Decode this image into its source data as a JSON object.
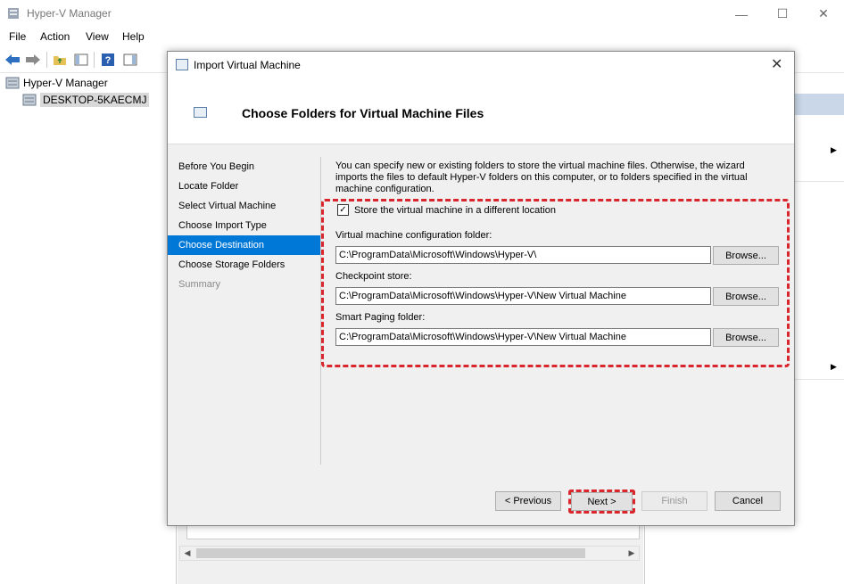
{
  "app": {
    "title": "Hyper-V Manager",
    "window_controls": {
      "minimize": "—",
      "maximize": "☐",
      "close": "✕"
    }
  },
  "menu": [
    "File",
    "Action",
    "View",
    "Help"
  ],
  "tree": {
    "root": "Hyper-V Manager",
    "host": "DESKTOP-5KAECMJ"
  },
  "dialog": {
    "title": "Import Virtual Machine",
    "heading": "Choose Folders for Virtual Machine Files",
    "close": "✕",
    "steps": [
      "Before You Begin",
      "Locate Folder",
      "Select Virtual Machine",
      "Choose Import Type",
      "Choose Destination",
      "Choose Storage Folders",
      "Summary"
    ],
    "active_step": "Choose Destination",
    "description": "You can specify new or existing folders to store the virtual machine files. Otherwise, the wizard imports the files to default Hyper-V folders on this computer, or to folders specified in the virtual machine configuration.",
    "checkbox": {
      "label": "Store the virtual machine in a different location",
      "checked": true,
      "mark": "✓"
    },
    "fields": {
      "config": {
        "label": "Virtual machine configuration folder:",
        "value": "C:\\ProgramData\\Microsoft\\Windows\\Hyper-V\\"
      },
      "checkpoint": {
        "label": "Checkpoint store:",
        "value": "C:\\ProgramData\\Microsoft\\Windows\\Hyper-V\\New Virtual Machine"
      },
      "paging": {
        "label": "Smart Paging folder:",
        "value": "C:\\ProgramData\\Microsoft\\Windows\\Hyper-V\\New Virtual Machine"
      }
    },
    "browse_label": "Browse...",
    "buttons": {
      "previous": "< Previous",
      "next": "Next >",
      "finish": "Finish",
      "cancel": "Cancel"
    }
  },
  "colors": {
    "accent": "#0078d7",
    "highlight": "#d9262c"
  }
}
